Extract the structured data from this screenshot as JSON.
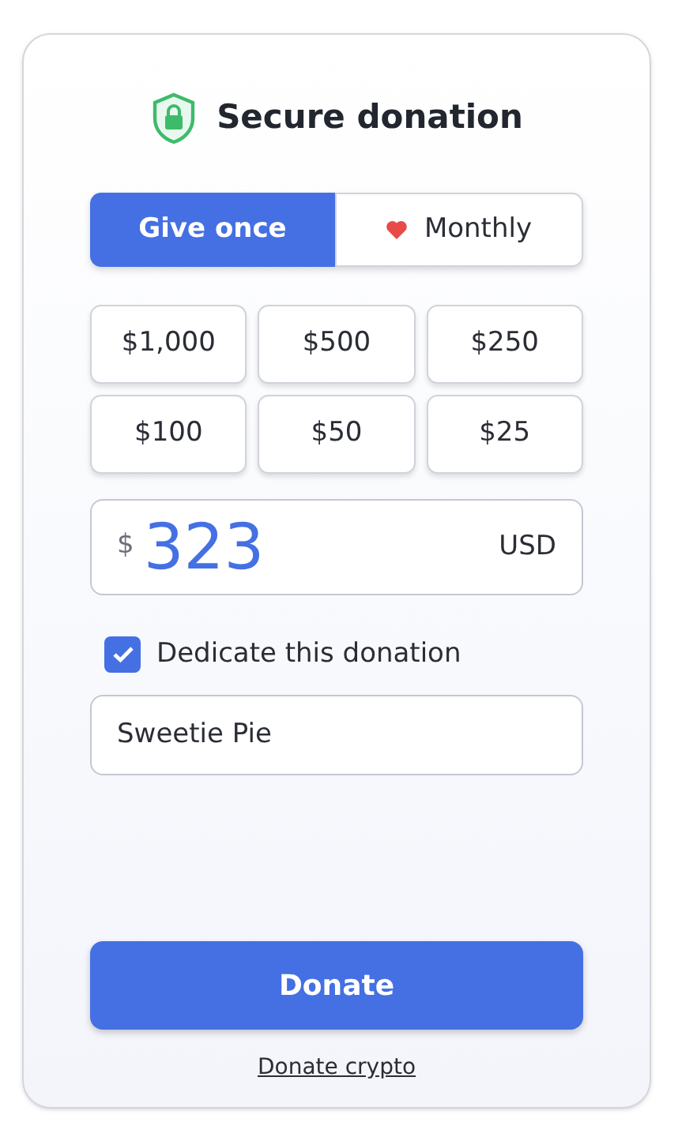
{
  "title": "Secure donation",
  "frequency_tabs": [
    {
      "label": "Give once",
      "selected": true,
      "kind": "plain"
    },
    {
      "label": "Monthly",
      "selected": false,
      "kind": "heart"
    }
  ],
  "amount_options": [
    "$1,000",
    "$500",
    "$250",
    "$100",
    "$50",
    "$25"
  ],
  "amount_field": {
    "currency_symbol": "$",
    "value": "323",
    "currency": "USD"
  },
  "dedicate": {
    "label": "Dedicate this donation",
    "checked": true
  },
  "dedication_field": {
    "value": "Sweetie Pie"
  },
  "donate_button": "Donate",
  "crypto_link": "Donate crypto"
}
